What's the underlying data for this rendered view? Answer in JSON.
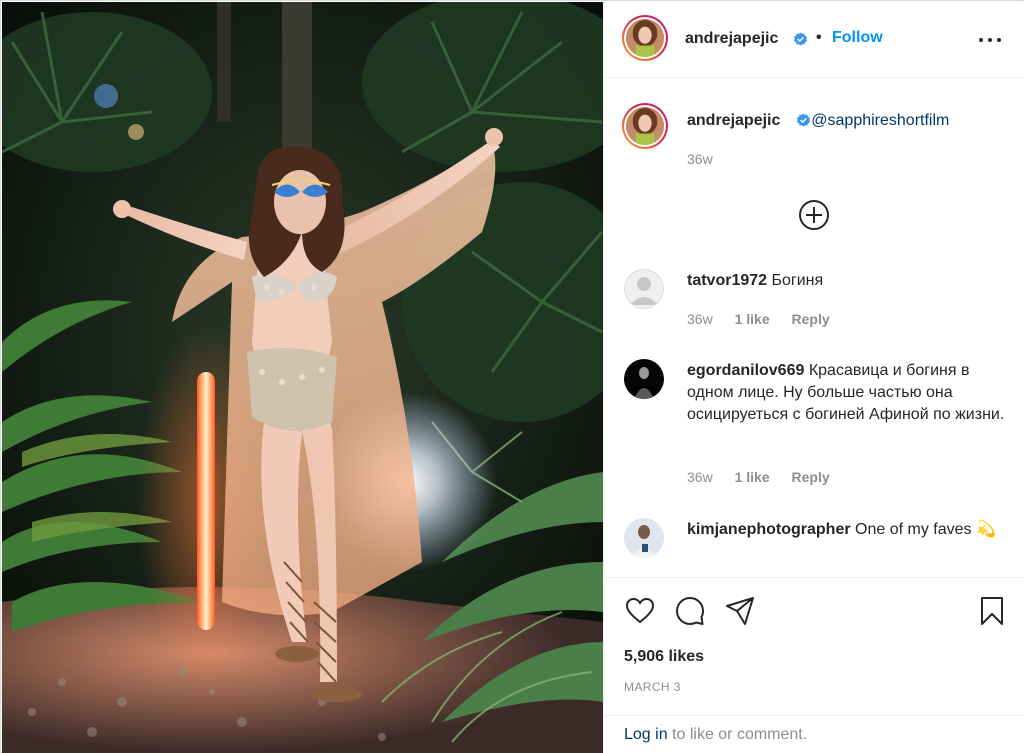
{
  "post": {
    "author": "andrejapejic",
    "follow_label": "Follow",
    "separator": "•"
  },
  "caption": {
    "username": "andrejapejic",
    "mention": "@sapphireshortfilm",
    "time": "36w"
  },
  "comments": [
    {
      "username": "tatvor1972",
      "text": "Богиня",
      "time": "36w",
      "likes": "1 like",
      "reply": "Reply"
    },
    {
      "username": "egordanilov669",
      "text": "Красавица и богиня в одном лице. Ну больше частью она осицируеться с богиней Афиной по жизни.",
      "time": "36w",
      "likes": "1 like",
      "reply": "Reply"
    },
    {
      "username": "kimjanephotographer",
      "text": "One of my faves 💫"
    }
  ],
  "actions": {
    "likes": "5,906 likes",
    "date": "MARCH 3",
    "login_link": "Log in",
    "login_rest": " to like or comment."
  },
  "icons": {
    "header_more": "more-options-icon",
    "verified": "verified-badge-icon",
    "load_more": "plus-circle-icon",
    "like": "heart-icon",
    "comment": "comment-icon",
    "share": "share-icon",
    "save": "bookmark-icon"
  },
  "colors": {
    "follow": "#0095f6",
    "link": "#00376b",
    "muted": "#8e8e8e",
    "verified": "#3897f0"
  }
}
